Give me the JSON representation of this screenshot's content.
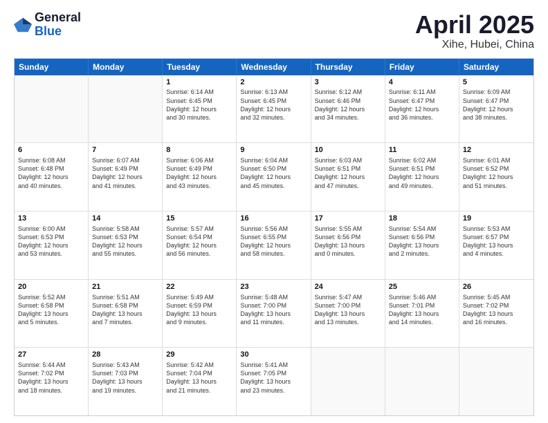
{
  "header": {
    "logo_general": "General",
    "logo_blue": "Blue",
    "title": "April 2025",
    "subtitle": "Xihe, Hubei, China"
  },
  "weekdays": [
    "Sunday",
    "Monday",
    "Tuesday",
    "Wednesday",
    "Thursday",
    "Friday",
    "Saturday"
  ],
  "rows": [
    [
      {
        "day": "",
        "text": "",
        "empty": true
      },
      {
        "day": "",
        "text": "",
        "empty": true
      },
      {
        "day": "1",
        "text": "Sunrise: 6:14 AM\nSunset: 6:45 PM\nDaylight: 12 hours\nand 30 minutes."
      },
      {
        "day": "2",
        "text": "Sunrise: 6:13 AM\nSunset: 6:45 PM\nDaylight: 12 hours\nand 32 minutes."
      },
      {
        "day": "3",
        "text": "Sunrise: 6:12 AM\nSunset: 6:46 PM\nDaylight: 12 hours\nand 34 minutes."
      },
      {
        "day": "4",
        "text": "Sunrise: 6:11 AM\nSunset: 6:47 PM\nDaylight: 12 hours\nand 36 minutes."
      },
      {
        "day": "5",
        "text": "Sunrise: 6:09 AM\nSunset: 6:47 PM\nDaylight: 12 hours\nand 38 minutes."
      }
    ],
    [
      {
        "day": "6",
        "text": "Sunrise: 6:08 AM\nSunset: 6:48 PM\nDaylight: 12 hours\nand 40 minutes."
      },
      {
        "day": "7",
        "text": "Sunrise: 6:07 AM\nSunset: 6:49 PM\nDaylight: 12 hours\nand 41 minutes."
      },
      {
        "day": "8",
        "text": "Sunrise: 6:06 AM\nSunset: 6:49 PM\nDaylight: 12 hours\nand 43 minutes."
      },
      {
        "day": "9",
        "text": "Sunrise: 6:04 AM\nSunset: 6:50 PM\nDaylight: 12 hours\nand 45 minutes."
      },
      {
        "day": "10",
        "text": "Sunrise: 6:03 AM\nSunset: 6:51 PM\nDaylight: 12 hours\nand 47 minutes."
      },
      {
        "day": "11",
        "text": "Sunrise: 6:02 AM\nSunset: 6:51 PM\nDaylight: 12 hours\nand 49 minutes."
      },
      {
        "day": "12",
        "text": "Sunrise: 6:01 AM\nSunset: 6:52 PM\nDaylight: 12 hours\nand 51 minutes."
      }
    ],
    [
      {
        "day": "13",
        "text": "Sunrise: 6:00 AM\nSunset: 6:53 PM\nDaylight: 12 hours\nand 53 minutes."
      },
      {
        "day": "14",
        "text": "Sunrise: 5:58 AM\nSunset: 6:53 PM\nDaylight: 12 hours\nand 55 minutes."
      },
      {
        "day": "15",
        "text": "Sunrise: 5:57 AM\nSunset: 6:54 PM\nDaylight: 12 hours\nand 56 minutes."
      },
      {
        "day": "16",
        "text": "Sunrise: 5:56 AM\nSunset: 6:55 PM\nDaylight: 12 hours\nand 58 minutes."
      },
      {
        "day": "17",
        "text": "Sunrise: 5:55 AM\nSunset: 6:56 PM\nDaylight: 13 hours\nand 0 minutes."
      },
      {
        "day": "18",
        "text": "Sunrise: 5:54 AM\nSunset: 6:56 PM\nDaylight: 13 hours\nand 2 minutes."
      },
      {
        "day": "19",
        "text": "Sunrise: 5:53 AM\nSunset: 6:57 PM\nDaylight: 13 hours\nand 4 minutes."
      }
    ],
    [
      {
        "day": "20",
        "text": "Sunrise: 5:52 AM\nSunset: 6:58 PM\nDaylight: 13 hours\nand 5 minutes."
      },
      {
        "day": "21",
        "text": "Sunrise: 5:51 AM\nSunset: 6:58 PM\nDaylight: 13 hours\nand 7 minutes."
      },
      {
        "day": "22",
        "text": "Sunrise: 5:49 AM\nSunset: 6:59 PM\nDaylight: 13 hours\nand 9 minutes."
      },
      {
        "day": "23",
        "text": "Sunrise: 5:48 AM\nSunset: 7:00 PM\nDaylight: 13 hours\nand 11 minutes."
      },
      {
        "day": "24",
        "text": "Sunrise: 5:47 AM\nSunset: 7:00 PM\nDaylight: 13 hours\nand 13 minutes."
      },
      {
        "day": "25",
        "text": "Sunrise: 5:46 AM\nSunset: 7:01 PM\nDaylight: 13 hours\nand 14 minutes."
      },
      {
        "day": "26",
        "text": "Sunrise: 5:45 AM\nSunset: 7:02 PM\nDaylight: 13 hours\nand 16 minutes."
      }
    ],
    [
      {
        "day": "27",
        "text": "Sunrise: 5:44 AM\nSunset: 7:02 PM\nDaylight: 13 hours\nand 18 minutes."
      },
      {
        "day": "28",
        "text": "Sunrise: 5:43 AM\nSunset: 7:03 PM\nDaylight: 13 hours\nand 19 minutes."
      },
      {
        "day": "29",
        "text": "Sunrise: 5:42 AM\nSunset: 7:04 PM\nDaylight: 13 hours\nand 21 minutes."
      },
      {
        "day": "30",
        "text": "Sunrise: 5:41 AM\nSunset: 7:05 PM\nDaylight: 13 hours\nand 23 minutes."
      },
      {
        "day": "",
        "text": "",
        "empty": true
      },
      {
        "day": "",
        "text": "",
        "empty": true
      },
      {
        "day": "",
        "text": "",
        "empty": true
      }
    ]
  ]
}
